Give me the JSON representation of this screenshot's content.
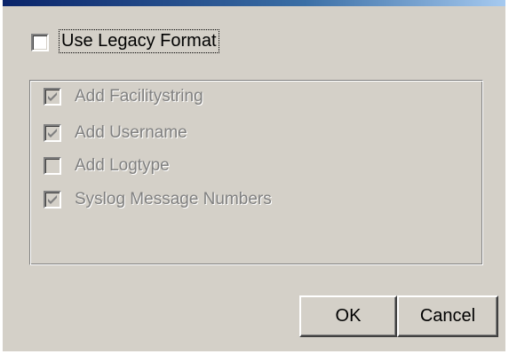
{
  "legacy_format": {
    "label": "Use Legacy Format",
    "checked": false
  },
  "options": [
    {
      "label": "Add Facilitystring",
      "checked": true,
      "enabled": false
    },
    {
      "label": "Add Username",
      "checked": true,
      "enabled": false
    },
    {
      "label": "Add Logtype",
      "checked": false,
      "enabled": false
    },
    {
      "label": "Syslog Message Numbers",
      "checked": true,
      "enabled": false
    }
  ],
  "buttons": {
    "ok_label": "OK",
    "cancel_label": "Cancel"
  },
  "colors": {
    "dialog_background": "#d4d0c8",
    "disabled_text": "#808080",
    "title_bar": "#0a246a"
  }
}
